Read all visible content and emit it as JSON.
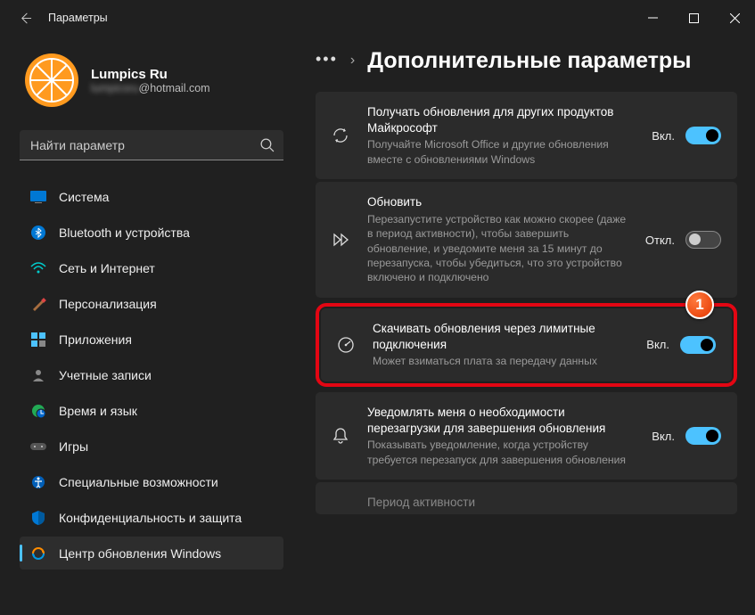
{
  "window": {
    "title": "Параметры"
  },
  "profile": {
    "name": "Lumpics Ru",
    "email_hidden": "lumpicsru",
    "email_domain": "@hotmail.com"
  },
  "search": {
    "placeholder": "Найти параметр"
  },
  "sidebar": {
    "items": [
      {
        "label": "Система"
      },
      {
        "label": "Bluetooth и устройства"
      },
      {
        "label": "Сеть и Интернет"
      },
      {
        "label": "Персонализация"
      },
      {
        "label": "Приложения"
      },
      {
        "label": "Учетные записи"
      },
      {
        "label": "Время и язык"
      },
      {
        "label": "Игры"
      },
      {
        "label": "Специальные возможности"
      },
      {
        "label": "Конфиденциальность и защита"
      },
      {
        "label": "Центр обновления Windows"
      }
    ]
  },
  "page": {
    "title": "Дополнительные параметры"
  },
  "settings": [
    {
      "title": "Получать обновления для других продуктов Майкрософт",
      "desc": "Получайте Microsoft Office и другие обновления вместе с обновлениями Windows",
      "state_label": "Вкл.",
      "state": true
    },
    {
      "title": "Обновить",
      "desc": "Перезапустите устройство как можно скорее (даже в период активности), чтобы завершить обновление, и уведомите меня за 15 минут до перезапуска, чтобы убедиться, что это устройство включено и подключено",
      "state_label": "Откл.",
      "state": false
    },
    {
      "title": "Скачивать обновления через лимитные подключения",
      "desc": "Может взиматься плата за передачу данных",
      "state_label": "Вкл.",
      "state": true
    },
    {
      "title": "Уведомлять меня о необходимости перезагрузки для завершения обновления",
      "desc": "Показывать уведомление, когда устройству требуется перезапуск для завершения обновления",
      "state_label": "Вкл.",
      "state": true
    },
    {
      "title": "Период активности",
      "desc": "",
      "state_label": "",
      "state": null
    }
  ],
  "annotation": {
    "number": "1",
    "color": "#e30613"
  }
}
